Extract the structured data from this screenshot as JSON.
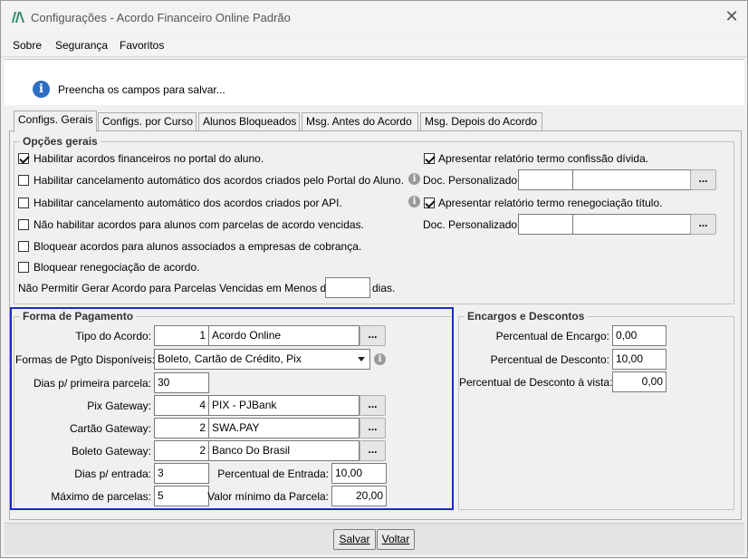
{
  "window": {
    "title": "Configurações - Acordo Financeiro Online Padrão"
  },
  "menu": [
    "Sobre",
    "Segurança",
    "Favoritos"
  ],
  "info_message": "Preencha os campos para salvar...",
  "tabs": [
    "Configs. Gerais",
    "Configs. por Curso",
    "Alunos Bloqueados",
    "Msg. Antes do Acordo",
    "Msg. Depois do Acordo"
  ],
  "opcoes_gerais": {
    "title": "Opções gerais",
    "left_checks": [
      {
        "label": "Habilitar acordos financeiros no portal do aluno.",
        "checked": true
      },
      {
        "label": "Habilitar cancelamento automático dos acordos criados pelo Portal do Aluno.",
        "checked": false
      },
      {
        "label": "Habilitar cancelamento automático dos acordos criados por API.",
        "checked": false
      },
      {
        "label": "Não habilitar acordos para alunos com parcelas de acordo vencidas.",
        "checked": false
      },
      {
        "label": "Bloquear acordos para alunos associados a empresas de cobrança.",
        "checked": false
      },
      {
        "label": "Bloquear renegociação de acordo.",
        "checked": false
      }
    ],
    "right_check_1": {
      "label": "Apresentar relatório termo confissão dívida.",
      "checked": true
    },
    "right_check_2": {
      "label": "Apresentar relatório termo renegociação título.",
      "checked": true
    },
    "doc_personalizado_label": "Doc. Personalizado:",
    "dias_prefix": "Não Permitir Gerar Acordo para Parcelas Vencidas em Menos de",
    "dias_value": "",
    "dias_suffix": "dias."
  },
  "forma_pagamento": {
    "title": "Forma de Pagamento",
    "tipo_acordo_label": "Tipo do Acordo:",
    "tipo_acordo_code": "1",
    "tipo_acordo_name": "Acordo Online",
    "formas_label": "Formas de Pgto Disponíveis:",
    "formas_value": "Boleto, Cartão de Crédito, Pix",
    "dias_primeira_label": "Dias p/ primeira parcela:",
    "dias_primeira_value": "30",
    "pix_label": "Pix Gateway:",
    "pix_code": "4",
    "pix_name": "PIX - PJBank",
    "cartao_label": "Cartão Gateway:",
    "cartao_code": "2",
    "cartao_name": "SWA.PAY",
    "boleto_label": "Boleto Gateway:",
    "boleto_code": "2",
    "boleto_name": "Banco Do Brasil",
    "dias_entrada_label": "Dias p/ entrada:",
    "dias_entrada_value": "3",
    "perc_entrada_label": "Percentual de Entrada:",
    "perc_entrada_value": "10,00",
    "max_parcelas_label": "Máximo de parcelas:",
    "max_parcelas_value": "5",
    "valor_min_label": "Valor mínimo da Parcela:",
    "valor_min_value": "20,00"
  },
  "encargos": {
    "title": "Encargos e Descontos",
    "encargo_label": "Percentual de Encargo:",
    "encargo_value": "0,00",
    "desconto_label": "Percentual de Desconto:",
    "desconto_value": "10,00",
    "desconto_vista_label": "Percentual de Desconto à vista:",
    "desconto_vista_value": "0,00"
  },
  "buttons": {
    "save": "Salvar",
    "back": "Voltar",
    "ellipsis": "..."
  },
  "colors": {
    "highlight": "#1a2bc9",
    "info_icon": "#2d6dc4"
  }
}
